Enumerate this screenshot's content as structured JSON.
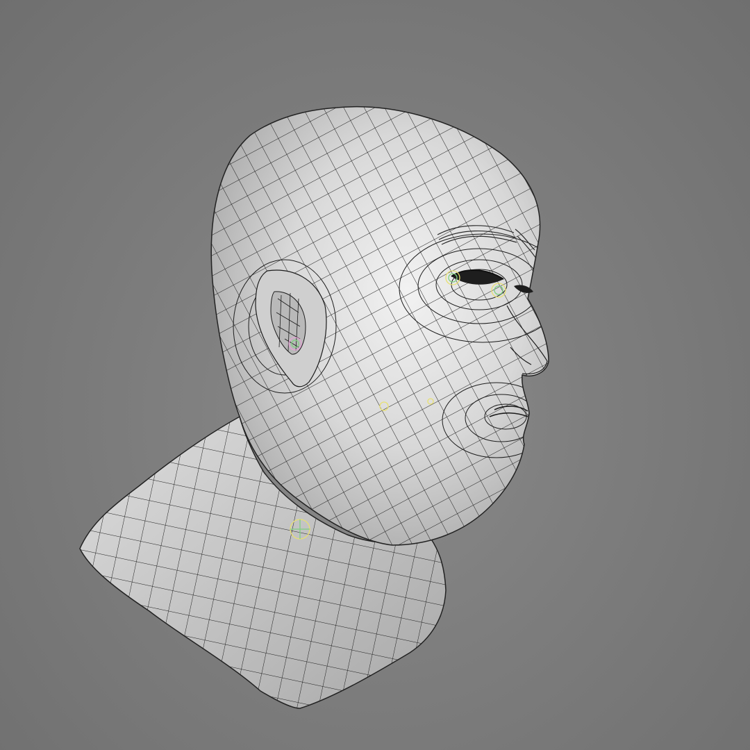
{
  "scene": {
    "background_color": "#7d7d7d",
    "model": {
      "subject": "head-bust",
      "display_mode": "wireframe-on-shaded",
      "surface_color": "#d9d9d9",
      "wire_color": "#1a1a1a",
      "joint_marker_colors": [
        "#e8e070",
        "#7fd07f",
        "#e6a2d6"
      ]
    }
  }
}
